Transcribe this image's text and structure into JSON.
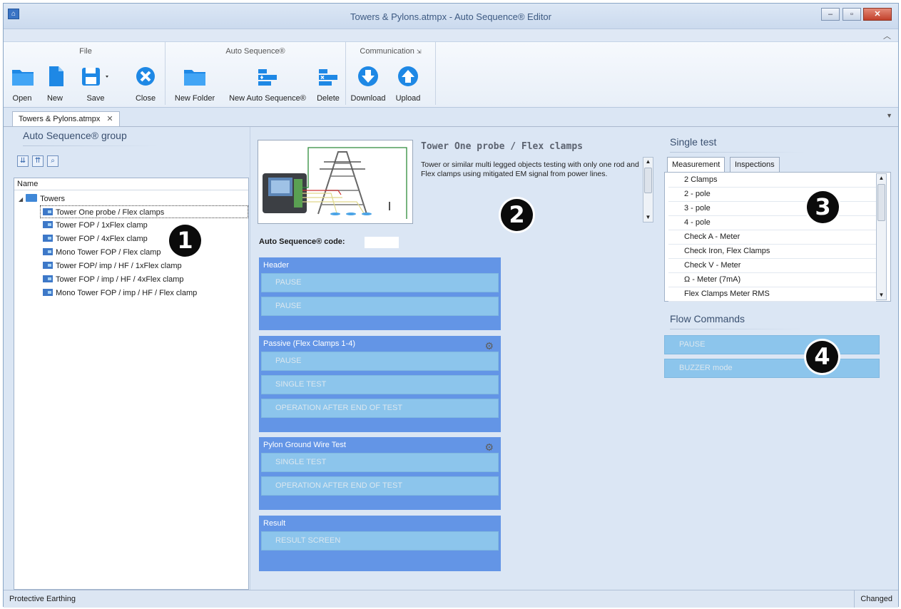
{
  "window": {
    "title": "Towers & Pylons.atmpx - Auto Sequence® Editor",
    "min": "–",
    "max": "▫",
    "close": "✕",
    "collapse": "︿"
  },
  "ribbon": {
    "groups": {
      "file": "File",
      "auto_sequence": "Auto Sequence®",
      "communication": "Communication"
    },
    "buttons": {
      "open": "Open",
      "new": "New",
      "save": "Save",
      "close": "Close",
      "new_folder": "New Folder",
      "new_auto_sequence": "New Auto Sequence®",
      "delete": "Delete",
      "download": "Download",
      "upload": "Upload"
    }
  },
  "document_tab": {
    "label": "Towers & Pylons.atmpx",
    "close": "✕"
  },
  "left_panel": {
    "title": "Auto Sequence® group",
    "column_header": "Name",
    "folder": "Towers",
    "items": [
      "Tower One probe / Flex clamps",
      "Tower FOP / 1xFlex clamp",
      "Tower FOP / 4xFlex clamp",
      "Mono Tower FOP / Flex clamp",
      "Tower FOP/ imp / HF / 1xFlex clamp",
      "Tower FOP / imp / HF / 4xFlex clamp",
      "Mono Tower FOP / imp / HF / Flex clamp"
    ]
  },
  "center_panel": {
    "preview_title": "Tower One probe / Flex clamps",
    "description": "Tower or similar multi legged objects testing with only one rod and Flex clamps using mitigated EM signal from power lines.",
    "code_label": "Auto Sequence® code:",
    "blocks": [
      {
        "title": "Header",
        "steps": [
          "PAUSE",
          "PAUSE"
        ]
      },
      {
        "title": "Passive (Flex Clamps 1-4)",
        "steps": [
          "PAUSE",
          "SINGLE TEST",
          "OPERATION AFTER END OF TEST"
        ]
      },
      {
        "title": "Pylon Ground Wire Test",
        "steps": [
          "SINGLE TEST",
          "OPERATION AFTER END OF TEST"
        ]
      },
      {
        "title": "Result",
        "steps": [
          "RESULT SCREEN"
        ]
      }
    ]
  },
  "right_panel": {
    "single_test_title": "Single test",
    "tabs": [
      "Measurement",
      "Inspections"
    ],
    "measurements": [
      "2 Clamps",
      "2 - pole",
      "3 - pole",
      "4 - pole",
      "Check A - Meter",
      "Check Iron, Flex Clamps",
      "Check V - Meter",
      "Ω - Meter (7mA)",
      "Flex Clamps Meter RMS"
    ],
    "flow_title": "Flow Commands",
    "flow_commands": [
      "PAUSE",
      "BUZZER mode"
    ]
  },
  "badges": [
    "1",
    "2",
    "3",
    "4"
  ],
  "status_bar": {
    "left": "Protective Earthing",
    "right": "Changed"
  },
  "colors": {
    "accent": "#6395e6",
    "step": "#8cc5ec",
    "icon_blue": "#1e88e5",
    "background": "#dbe6f4"
  }
}
